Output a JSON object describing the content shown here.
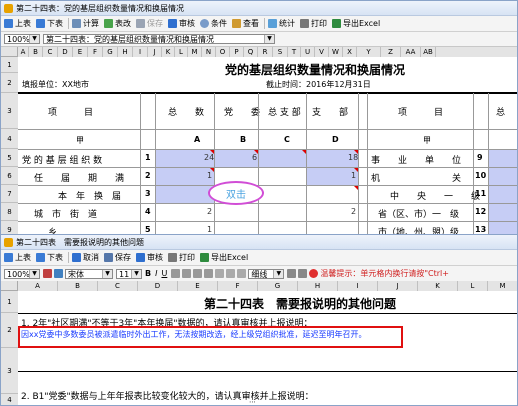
{
  "top_window": {
    "title": "第二十四表：党的基层组织数量情况和换届情况",
    "toolbar": [
      "上表",
      "下表",
      "计算",
      "表改",
      "保存",
      "审核",
      "条件",
      "查看",
      "统计",
      "打印",
      "导出Excel"
    ],
    "zoom": "100%",
    "sheet_select": "第二十四表：党的基层组织数量情况和换届情况",
    "col_letters": [
      "A",
      "B",
      "C",
      "D",
      "E",
      "F",
      "G",
      "H",
      "I",
      "J",
      "K",
      "L",
      "M",
      "N",
      "O",
      "P",
      "Q",
      "R",
      "S",
      "T",
      "U",
      "V",
      "W",
      "X",
      "Y",
      "Z",
      "AA",
      "AB"
    ],
    "row_numbers": [
      "1",
      "2",
      "3",
      "4",
      "5",
      "6",
      "7",
      "8",
      "9",
      "10",
      "11"
    ],
    "sheet_title": "党的基层组织数量情况和换届情况",
    "unit_label": "填报单位：XX地市",
    "deadline_label": "截止时间：2016年12月31日",
    "headers": {
      "item": "项　　　目",
      "total": "总　　数",
      "party_committee": "党　　委",
      "general_branch": "总 支 部",
      "branch": "支　　部",
      "item_right": "项　　　目",
      "total_right": "总"
    },
    "row5": {
      "jia": "甲",
      "a": "A",
      "b": "B",
      "c": "C",
      "d": "D",
      "jia_right": "甲"
    },
    "row7": {
      "label": "党 的 基 层 组 织 数",
      "num": "1",
      "total": "24",
      "committee": "6",
      "branch": "18",
      "right_label": "事　　业　　单　　位",
      "right_num": "9"
    },
    "row8": {
      "label": "任　　届　　期　　满",
      "num": "2",
      "total": "1",
      "branch": "1",
      "right_label": "机　　　　　　　　关",
      "right_num": "10"
    },
    "row9": {
      "label": "本　年　换　届",
      "num": "3",
      "callout": "双击",
      "right_label": "中　　央　　一　　级",
      "right_num": "11"
    },
    "row10": {
      "label": "城　市　街　道",
      "num": "4",
      "total": "2",
      "branch": "2",
      "right_label": "省（区、市）一　级",
      "right_num": "12"
    },
    "row11": {
      "label": "乡",
      "num": "5",
      "total": "1",
      "right_label": "市（地、州、盟）级",
      "right_num": "13"
    }
  },
  "bottom_window": {
    "title": "第二十四表　需要报说明的其他问题",
    "toolbar": [
      "上表",
      "下表",
      "取消",
      "保存",
      "审核",
      "打印",
      "导出Excel"
    ],
    "zoom": "100%",
    "font": "宋体",
    "font_size": "11",
    "format_buttons": [
      "B",
      "I",
      "U"
    ],
    "border_select": "细线",
    "warning": "温馨提示：单元格内换行请按\"Ctrl+",
    "col_letters": [
      "A",
      "B",
      "C",
      "D",
      "E",
      "F",
      "G",
      "H",
      "I",
      "J",
      "K",
      "L",
      "M"
    ],
    "row_numbers": [
      "1",
      "2",
      "3",
      "4"
    ],
    "line1": "1. 2年\"社区期满\"不等于3年\"本年换届\"数据的，请认真审核并上报说明：",
    "line1_answer": "因xx党委中多数委员被派遣临时外出工作，无法按期改选，经上级党组织批准，延迟至明年召开。",
    "line2": "2. B1\"党委\"数据与上年年报表比较变化较大的，请认真审核并上报说明："
  }
}
